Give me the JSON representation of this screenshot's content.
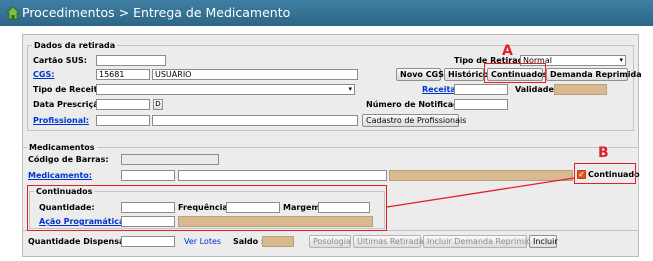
{
  "window": {
    "title": "Procedimentos > Entrega de Medicamento"
  },
  "retirada": {
    "legend": "Dados da retirada",
    "cartao_sus_label": "Cartão SUS:",
    "cartao_sus_value": "",
    "tipo_retirada_label": "Tipo de Retirada:",
    "tipo_retirada_value": "Normal",
    "cgs_label": "CGS:",
    "cgs_code": "15681",
    "cgs_name": "USUÁRIO",
    "btn_novo_cgs": "Novo CGS",
    "btn_historico": "Histórico",
    "btn_continuados": "Continuados",
    "btn_demanda_reprimida": "Demanda Reprimida",
    "tipo_receita_label": "Tipo de Receita:",
    "tipo_receita_value": "",
    "receita_label": "Receita:",
    "receita_value": "",
    "validade_label": "Validade:",
    "validade_value": "",
    "data_prescricao_label": "Data Prescrição:",
    "data_prescricao_value": "",
    "date_button": "D",
    "num_notificacao_label": "Número de Notificação:",
    "num_notificacao_value": "",
    "profissional_label": "Profissional:",
    "profissional_code": "",
    "profissional_name": "",
    "btn_cadastro_profissionais": "Cadastro de Profissionais"
  },
  "medicamentos": {
    "legend": "Medicamentos",
    "codigo_barras_label": "Código de Barras:",
    "codigo_barras_value": "",
    "medicamento_label": "Medicamento:",
    "medicamento_code": "",
    "medicamento_name": "",
    "medicamento_extra": "",
    "continuado_label": "Continuado",
    "continuado_checked": true
  },
  "continuados": {
    "legend": "Continuados",
    "quantidade_label": "Quantidade:",
    "quantidade_value": "",
    "frequencia_label": "Frequência:",
    "frequencia_value": "",
    "margem_label": "Margem:",
    "margem_value": "",
    "acao_programatica_label": "Ação Programática:",
    "acao_code": "",
    "acao_name": ""
  },
  "bottom": {
    "qtd_dispensada_label": "Quantidade Dispensada:",
    "qtd_dispensada_value": "",
    "ver_lotes": "Ver Lotes",
    "saldo_label": "Saldo :",
    "saldo_value": "",
    "btn_posologia": "Posologia",
    "btn_ultimas_retiradas": "Últimas Retiradas",
    "btn_incluir_demanda": "Incluir Demanda Reprimida",
    "btn_incluir": "Incluir"
  },
  "annotations": {
    "a": "A",
    "b": "B"
  },
  "colors": {
    "titlebar": "#3a789b",
    "annotation": "#e3202a",
    "readonly_field": "#d9b98f",
    "link": "#0033cc"
  }
}
